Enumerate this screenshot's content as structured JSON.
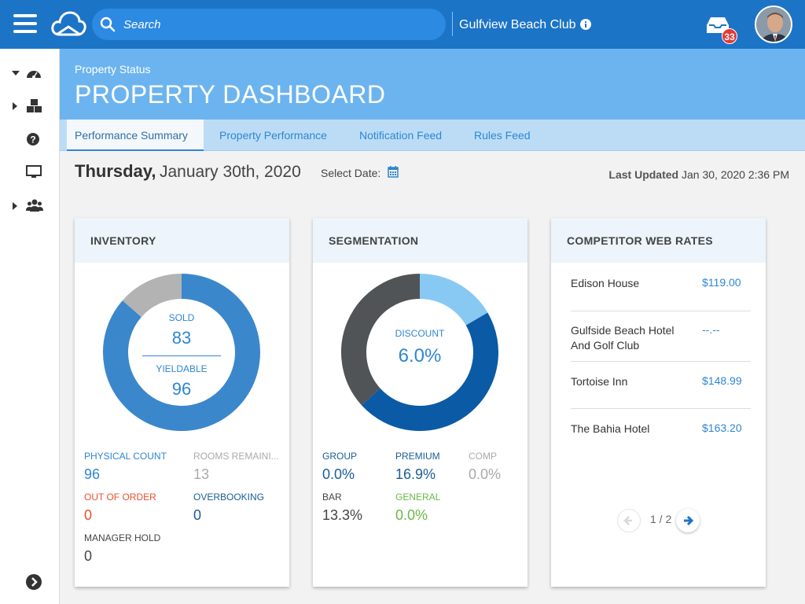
{
  "topbar": {
    "search_placeholder": "Search",
    "property_name": "Gulfview Beach Club",
    "inbox_count": "33"
  },
  "header": {
    "subtitle": "Property Status",
    "title": "PROPERTY DASHBOARD"
  },
  "tabs": [
    {
      "label": "Performance Summary",
      "active": true
    },
    {
      "label": "Property Performance",
      "active": false
    },
    {
      "label": "Notification Feed",
      "active": false
    },
    {
      "label": "Rules Feed",
      "active": false
    }
  ],
  "date": {
    "day": "Thursday,",
    "rest": "January 30th, 2020",
    "select_label": "Select Date:",
    "last_updated_label": "Last Updated",
    "last_updated_value": "Jan 30, 2020 2:36 PM"
  },
  "inventory": {
    "title": "INVENTORY",
    "sold_label": "SOLD",
    "sold_value": "83",
    "yieldable_label": "YIELDABLE",
    "yieldable_value": "96",
    "stats": [
      {
        "label": "PHYSICAL COUNT",
        "value": "96",
        "color": "#2f86d0"
      },
      {
        "label": "ROOMS REMAINI...",
        "value": "13",
        "color": "#aaaaaa"
      },
      {
        "label": "OUT OF ORDER",
        "value": "0",
        "color": "#e8502f"
      },
      {
        "label": "OVERBOOKING",
        "value": "0",
        "color": "#1a5d96"
      },
      {
        "label": "MANAGER HOLD",
        "value": "0",
        "color": "#444444"
      }
    ],
    "chart_data": {
      "type": "pie",
      "categories": [
        "Sold",
        "Remaining"
      ],
      "values": [
        83,
        13
      ],
      "colors": [
        "#3b87cc",
        "#b3b3b3"
      ]
    }
  },
  "segmentation": {
    "title": "SEGMENTATION",
    "center_label": "DISCOUNT",
    "center_value": "6.0%",
    "stats": [
      {
        "label": "GROUP",
        "value": "0.0%",
        "color": "#1a5d96"
      },
      {
        "label": "PREMIUM",
        "value": "16.9%",
        "color": "#1a5d96"
      },
      {
        "label": "COMP",
        "value": "0.0%",
        "color": "#aaaaaa"
      },
      {
        "label": "BAR",
        "value": "13.3%",
        "color": "#444444"
      },
      {
        "label": "GENERAL",
        "value": "0.0%",
        "color": "#6ab945"
      }
    ],
    "chart_data": {
      "type": "pie",
      "categories": [
        "Discount",
        "Premium",
        "Bar"
      ],
      "values": [
        6.0,
        16.9,
        13.3
      ],
      "colors": [
        "#87c9f3",
        "#0a5aa6",
        "#505456"
      ]
    }
  },
  "competitors": {
    "title": "COMPETITOR WEB RATES",
    "rows": [
      {
        "name": "Edison House",
        "price": "$119.00"
      },
      {
        "name": "Gulfside Beach Hotel And Golf Club",
        "price": "--.--"
      },
      {
        "name": "Tortoise Inn",
        "price": "$148.99"
      },
      {
        "name": "The Bahia Hotel",
        "price": "$163.20"
      }
    ],
    "pager": "1 / 2"
  }
}
